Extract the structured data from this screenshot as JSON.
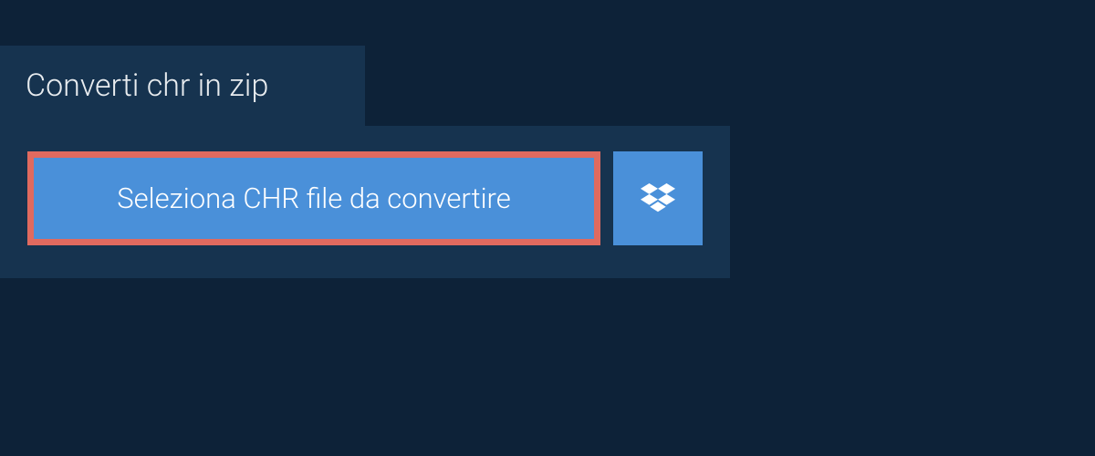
{
  "tab": {
    "title": "Converti chr in zip"
  },
  "actions": {
    "select_file_label": "Seleziona CHR file da convertire",
    "dropbox_icon": "dropbox"
  },
  "colors": {
    "page_bg": "#0d2238",
    "panel_bg": "#16334f",
    "button_bg": "#4a90d9",
    "button_border": "#e06a5f",
    "text_light": "#ffffff"
  }
}
